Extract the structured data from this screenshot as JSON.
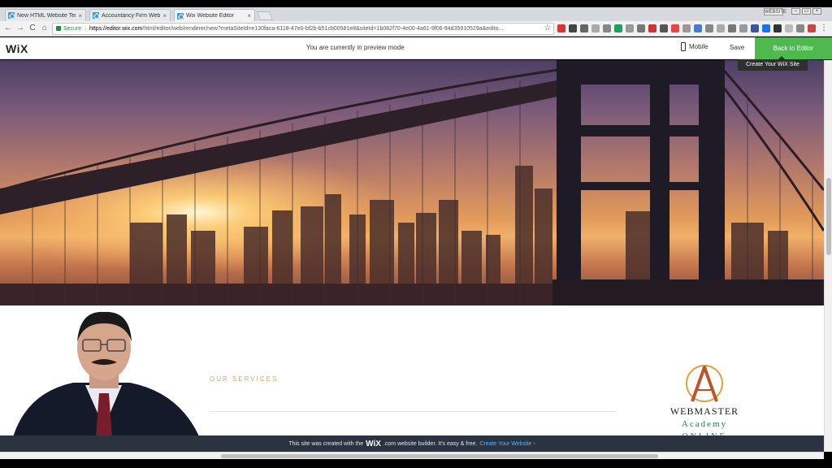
{
  "browser": {
    "tabs": [
      {
        "title": "New HTML Website Tem",
        "active": false
      },
      {
        "title": "Accountancy Firm Websi",
        "active": false
      },
      {
        "title": "Wix Website Editor",
        "active": true
      }
    ],
    "tab_close": "×",
    "user_badge": "WEBSITE",
    "window_buttons": [
      "–",
      "▭",
      "×"
    ],
    "address": {
      "secure_label": "Secure",
      "url_host": "https://editor.wix.com",
      "url_rest": "/html/editor/web/renderer/new?metaSiteId=e130faca-6118-47e0-bf2b-b51cb00581e8&siteId=1b082f70-4e00-4a61-9f06-94d35910529a&edito..."
    },
    "nav_icons": {
      "back": "←",
      "forward": "→",
      "reload": "C",
      "home": "⌂",
      "star": "☆",
      "menu": "⋮"
    }
  },
  "wix": {
    "logo": "WiX",
    "preview_message": "You are currently in preview mode",
    "mobile_label": "Mobile",
    "save_label": "Save",
    "back_label": "Back to Editor",
    "tooltip": "Create Your WiX Site"
  },
  "page": {
    "section_heading": "OUR SERVICES"
  },
  "academy": {
    "line1": "WEBMASTER",
    "line2": "Academy",
    "line3": "ONLINE"
  },
  "banner": {
    "prefix": "This site was created with the",
    "brand": "WiX",
    "middle": ".com website builder. It's easy & free.",
    "link": "Create Your Website ›"
  },
  "colors": {
    "wix_green": "#4eb94e",
    "banner_bg": "#2b3340",
    "link_blue": "#57b4ff",
    "services_gold": "#d9a96c"
  }
}
